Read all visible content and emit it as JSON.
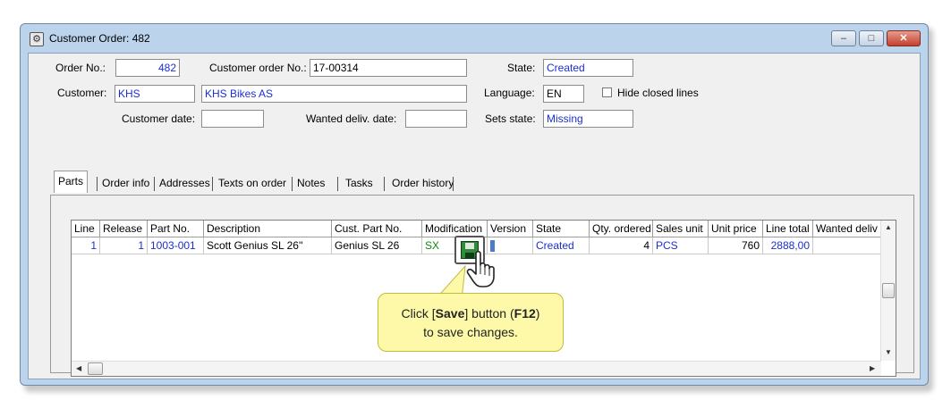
{
  "window": {
    "title": "Customer Order: 482",
    "buttons": {
      "minimize": "–",
      "maximize": "□",
      "close": "✕"
    }
  },
  "header": {
    "order_no_label": "Order No.:",
    "order_no_value": "482",
    "customer_order_no_label": "Customer order No.:",
    "customer_order_no_value": "17-00314",
    "state_label": "State:",
    "state_value": "Created",
    "customer_label": "Customer:",
    "customer_code": "KHS",
    "customer_name": "KHS Bikes AS",
    "language_label": "Language:",
    "language_value": "EN",
    "hide_closed_lines_label": "Hide closed lines",
    "customer_date_label": "Customer date:",
    "customer_date_value": "",
    "wanted_deliv_date_label": "Wanted deliv. date:",
    "wanted_deliv_date_value": "",
    "sets_state_label": "Sets state:",
    "sets_state_value": "Missing"
  },
  "tabs": [
    {
      "label": "Parts",
      "active": true
    },
    {
      "label": "Order info"
    },
    {
      "label": "Addresses"
    },
    {
      "label": "Texts on order"
    },
    {
      "label": "Notes"
    },
    {
      "label": "Tasks"
    },
    {
      "label": "Order history"
    }
  ],
  "grid": {
    "columns": [
      "Line",
      "Release",
      "Part No.",
      "Description",
      "Cust. Part No.",
      "Modification",
      "Version",
      "State",
      "Qty. ordered",
      "Sales unit",
      "Unit price",
      "Line total",
      "Wanted deliv"
    ],
    "rows": [
      {
        "line": "1",
        "release": "1",
        "part_no": "1003-001",
        "description": "Scott Genius SL 26''",
        "cust_part_no": "Genius SL 26",
        "modification": "SX",
        "version": "",
        "state": "Created",
        "qty_ordered": "4",
        "sales_unit": "PCS",
        "unit_price": "760",
        "line_total": "2888,00",
        "wanted_deliv": ""
      }
    ]
  },
  "overlay": {
    "icon": "save-floppy-icon",
    "callout_line1_prefix": "Click [",
    "callout_bold1": "Save",
    "callout_line1_mid": "] button (",
    "callout_bold2": "F12",
    "callout_line1_suffix": ")",
    "callout_line2": "to save changes."
  },
  "colors": {
    "link_blue": "#1a2fd0",
    "mod_green": "#0a8a0a",
    "callout_bg": "#fdf9a8",
    "window_frame": "#bcd3ec"
  }
}
